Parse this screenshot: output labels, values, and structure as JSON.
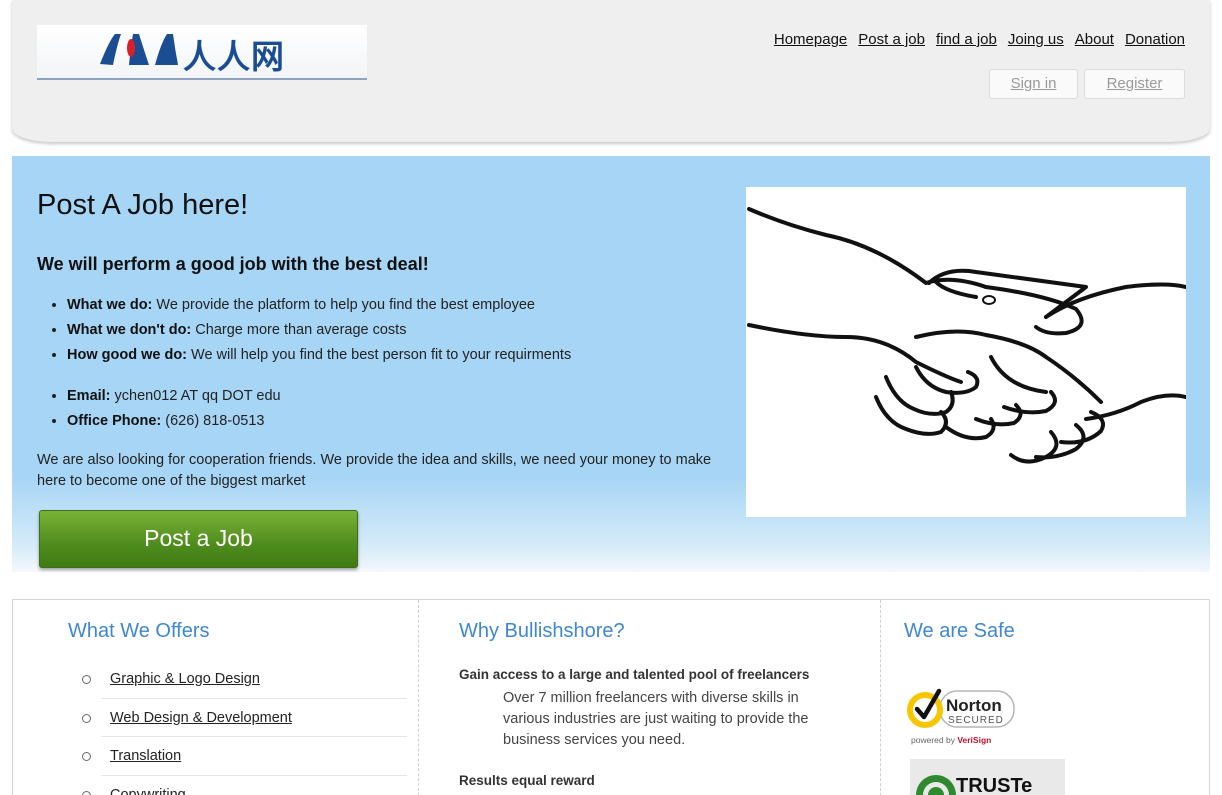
{
  "logo": {
    "text": "人人网"
  },
  "nav": {
    "items": [
      {
        "label": "Homepage"
      },
      {
        "label": "Post a job"
      },
      {
        "label": "find a job"
      },
      {
        "label": "Joing us"
      },
      {
        "label": "About"
      },
      {
        "label": "Donation"
      }
    ]
  },
  "auth": {
    "signin": "Sign in",
    "register": "Register"
  },
  "hero": {
    "title": "Post A Job here!",
    "subtitle": "We will perform a good job with the best deal!",
    "features": [
      {
        "label": "What we do:",
        "text": " We provide the platform to help you find the best employee"
      },
      {
        "label": "What we don't do:",
        "text": " Charge more than average costs"
      },
      {
        "label": "How good we do:",
        "text": " We will help you find the best person fit to your requirments"
      }
    ],
    "contacts": [
      {
        "label": "Email:",
        "text": " ychen012 AT qq DOT edu"
      },
      {
        "label": "Office Phone:",
        "text": " (626) 818-0513"
      }
    ],
    "cooperation": "We are also looking for cooperation friends. We provide the idea and skills, we need your money to make here to become one of the biggest market",
    "button": "Post a Job"
  },
  "offers": {
    "title": "What We Offers",
    "items": [
      "Graphic & Logo Design",
      "Web Design & Development",
      "Translation",
      "Copywriting"
    ]
  },
  "why": {
    "title": "Why Bullishshore?",
    "point1_title": "Gain access to a large and talented pool of freelancers",
    "point1_text": "Over 7 million freelancers with diverse skills in various industries are just waiting to provide the business services you need.",
    "point2_title": "Results equal reward"
  },
  "safe": {
    "title": "We are Safe",
    "norton_name": "Norton",
    "norton_secured": "SECURED",
    "norton_powered": "powered by ",
    "norton_brand": "VeriSign",
    "truste": "TRUSTe"
  },
  "colors": {
    "accent_blue": "#3f87cf",
    "hero_bg": "#a6d5f5",
    "button_green": "#4f8c1d"
  }
}
